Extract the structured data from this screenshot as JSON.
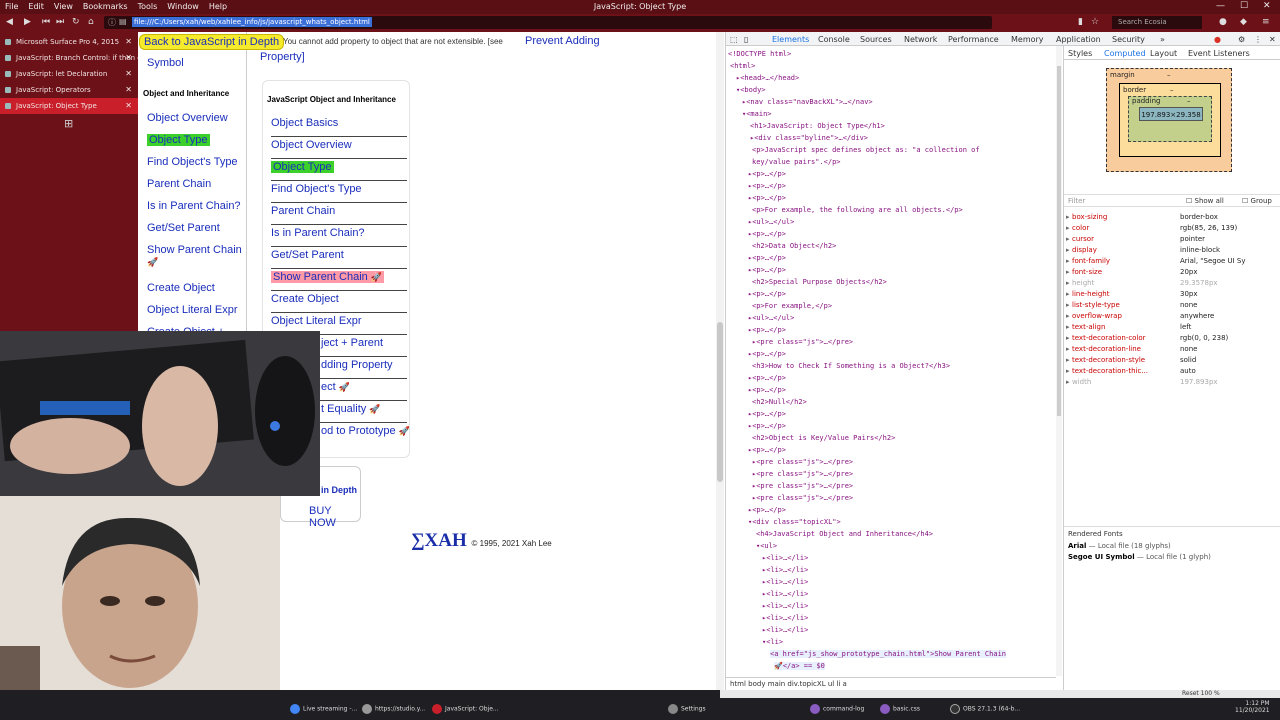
{
  "window": {
    "menu": [
      "File",
      "Edit",
      "View",
      "Bookmarks",
      "Tools",
      "Window",
      "Help"
    ],
    "title": "JavaScript: Object Type",
    "url": "file:///C:/Users/xah/web/xahlee_info/js/javascript_whats_object.html",
    "search_placeholder": "Search Ecosia"
  },
  "tabs": [
    {
      "label": "Microsoft Surface Pro 4, 2015",
      "active": false
    },
    {
      "label": "JavaScript: Branch Control: if then el...",
      "active": false
    },
    {
      "label": "JavaScript: let Declaration",
      "active": false
    },
    {
      "label": "JavaScript: Operators",
      "active": false
    },
    {
      "label": "JavaScript: Object Type",
      "active": true
    }
  ],
  "page": {
    "back_link": "Back to JavaScript in Depth",
    "intro_text": "You cannot add property to object that are not extensible. [see",
    "intro_link": "Prevent Adding",
    "intro_link2": "Property]",
    "sidebar": {
      "top_item": "Symbol",
      "heading": "Object and Inheritance",
      "items": [
        "Object Overview",
        "Object Type",
        "Find Object's Type",
        "Parent Chain",
        "Is in Parent Chain?",
        "Get/Set Parent",
        "Show Parent Chain",
        "Create Object",
        "Object Literal Expr",
        "Create Object +"
      ]
    },
    "topic_box": {
      "heading": "JavaScript Object and Inheritance",
      "items": [
        "Object Basics",
        "Object Overview",
        "Object Type",
        "Find Object's Type",
        "Parent Chain",
        "Is in Parent Chain?",
        "Get/Set Parent",
        "Show Parent Chain",
        "Create Object",
        "Object Literal Expr",
        "ject + Parent",
        "dding Property",
        "ect",
        "t Equality",
        "od to Prototype"
      ]
    },
    "book_box": {
      "title": "in Depth",
      "buy": "BUY NOW"
    },
    "footer": {
      "logo": "∑XAH",
      "copyright": "© 1995, 2021 Xah Lee"
    }
  },
  "devtools": {
    "tabs": [
      "Elements",
      "Console",
      "Sources",
      "Network",
      "Performance",
      "Memory",
      "Application",
      "Security"
    ],
    "right_tabs": [
      "Styles",
      "Computed",
      "Layout",
      "Event Listeners"
    ],
    "box_model": {
      "margin": "margin",
      "border": "border",
      "padding": "padding",
      "dash": "–",
      "content": "197.893×29.358"
    },
    "filter_placeholder": "Filter",
    "show_all": "Show all",
    "group": "Group",
    "computed": [
      {
        "name": "box-sizing",
        "value": "border-box",
        "dim": false
      },
      {
        "name": "color",
        "value": "rgb(85, 26, 139)",
        "dim": false
      },
      {
        "name": "cursor",
        "value": "pointer",
        "dim": false
      },
      {
        "name": "display",
        "value": "inline-block",
        "dim": false
      },
      {
        "name": "font-family",
        "value": "Arial, \"Segoe UI Sy",
        "dim": false
      },
      {
        "name": "font-size",
        "value": "20px",
        "dim": false
      },
      {
        "name": "height",
        "value": "29.3578px",
        "dim": true
      },
      {
        "name": "line-height",
        "value": "30px",
        "dim": false
      },
      {
        "name": "list-style-type",
        "value": "none",
        "dim": false
      },
      {
        "name": "overflow-wrap",
        "value": "anywhere",
        "dim": false
      },
      {
        "name": "text-align",
        "value": "left",
        "dim": false
      },
      {
        "name": "text-decoration-color",
        "value": "rgb(0, 0, 238)",
        "dim": false
      },
      {
        "name": "text-decoration-line",
        "value": "none",
        "dim": false
      },
      {
        "name": "text-decoration-style",
        "value": "solid",
        "dim": false
      },
      {
        "name": "text-decoration-thic...",
        "value": "auto",
        "dim": false
      },
      {
        "name": "width",
        "value": "197.893px",
        "dim": true
      }
    ],
    "rendered_fonts": {
      "heading": "Rendered Fonts",
      "fonts": [
        {
          "name": "Arial",
          "detail": "— Local file (18 glyphs)"
        },
        {
          "name": "Segoe UI Symbol",
          "detail": "— Local file (1 glyph)"
        }
      ]
    },
    "dom_lines": [
      "<!DOCTYPE html>",
      "<html>",
      "▸<head>…</head>",
      "▾<body>",
      "▸<nav class=\"navBackXL\">…</nav>",
      "▾<main>",
      "<h1>JavaScript: Object Type</h1>",
      "▸<div class=\"byline\">…</div>",
      "<p>JavaScript spec defines object as: \"a collection of",
      "key/value pairs\".</p>",
      "▸<p>…</p>",
      "▸<p>…</p>",
      "▸<p>…</p>",
      "<p>For example, the following are all objects.</p>",
      "▸<ul>…</ul>",
      "▸<p>…</p>",
      "<h2>Data Object</h2>",
      "▸<p>…</p>",
      "▸<p>…</p>",
      "<h2>Special Purpose Objects</h2>",
      "▸<p>…</p>",
      "<p>For example,</p>",
      "▸<ul>…</ul>",
      "▸<p>…</p>",
      "▸<pre class=\"js\">…</pre>",
      "▸<p>…</p>",
      "<h3>How to Check If Something is a Object?</h3>",
      "▸<p>…</p>",
      "▸<p>…</p>",
      "<h2>Null</h2>",
      "▸<p>…</p>",
      "▸<p>…</p>",
      "<h2>Object is Key/Value Pairs</h2>",
      "▸<p>…</p>",
      "▸<pre class=\"js\">…</pre>",
      "▸<pre class=\"js\">…</pre>",
      "▸<pre class=\"js\">…</pre>",
      "▸<pre class=\"js\">…</pre>",
      "▸<p>…</p>",
      "▾<div class=\"topicXL\">",
      "<h4>JavaScript Object and Inheritance</h4>",
      "▾<ul>",
      "▸<li>…</li>",
      "▸<li>…</li>",
      "▸<li>…</li>",
      "▸<li>…</li>",
      "▸<li>…</li>",
      "▸<li>…</li>",
      "▸<li>…</li>",
      "▾<li>",
      "<a href=\"js_show_prototype_chain.html\">Show Parent Chain",
      "🚀</a> == $0"
    ],
    "breadcrumbs": "html  body  main  div.topicXL  ul  li  a"
  },
  "taskbar": {
    "items": [
      "Live streaming -...",
      "https://studio.y...",
      "JavaScript: Obje...",
      "Settings",
      "command-log",
      "basic.css",
      "OBS 27.1.3 (64-b..."
    ],
    "status": "Reset  100 %",
    "time": "1:12 PM",
    "date": "11/20/2021"
  },
  "colors": {
    "accent": "#c81f2a",
    "link": "#1a2ebb",
    "highlight_green": "#3bd12a",
    "highlight_pink": "#ff9aa6",
    "back_yellow": "#f6ea2d"
  }
}
